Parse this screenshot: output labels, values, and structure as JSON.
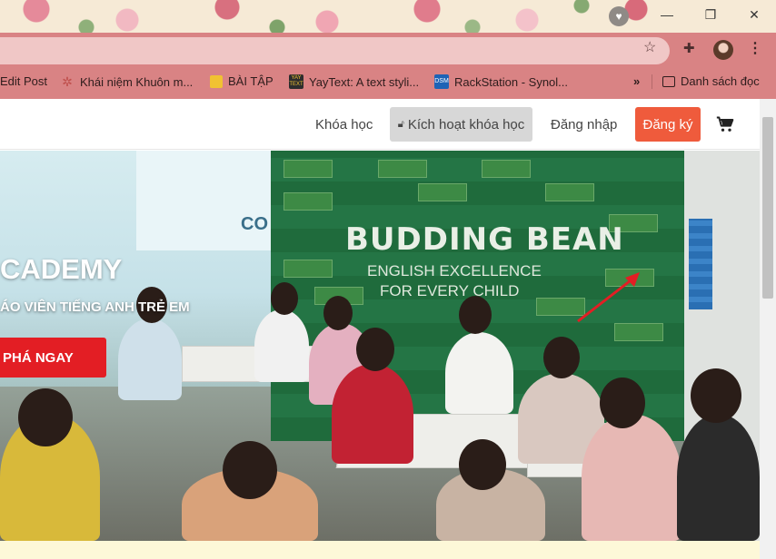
{
  "browser": {
    "profile_badge": "♥",
    "window_controls": {
      "minimize": "—",
      "restore": "❐",
      "close": "✕"
    },
    "bookmarks": [
      {
        "label": "Edit Post",
        "icon": "none"
      },
      {
        "label": "Khái niệm Khuôn m...",
        "icon": "pinwheel-icon",
        "color": "#c0504d"
      },
      {
        "label": "BÀI TẬP",
        "icon": "folder-icon",
        "color": "#f1c232"
      },
      {
        "label": "YayText: A text styli...",
        "icon": "yaytext-icon",
        "color": "#2d2d2d"
      },
      {
        "label": "RackStation - Synol...",
        "icon": "dsm-icon",
        "color": "#1e63b6"
      }
    ],
    "overflow_chevron": "»",
    "reading_list": "Danh sách đọc"
  },
  "nav": {
    "courses": "Khóa học",
    "activate_course": "Kích hoạt khóa học",
    "login": "Đăng nhập",
    "register": "Đăng ký",
    "accent_color": "#ef5b3c"
  },
  "hero": {
    "title": "CADEMY",
    "subtitle": "ÁO VIÊN TIẾNG ANH TRẺ EM",
    "cta": "PHÁ NGAY",
    "banner_title": "BUDDING BEAN",
    "banner_line1": "ENGLISH EXCELLENCE",
    "banner_line2": "FOR EVERY CHILD",
    "wall_text": "CO",
    "cta_color": "#e31e24"
  }
}
